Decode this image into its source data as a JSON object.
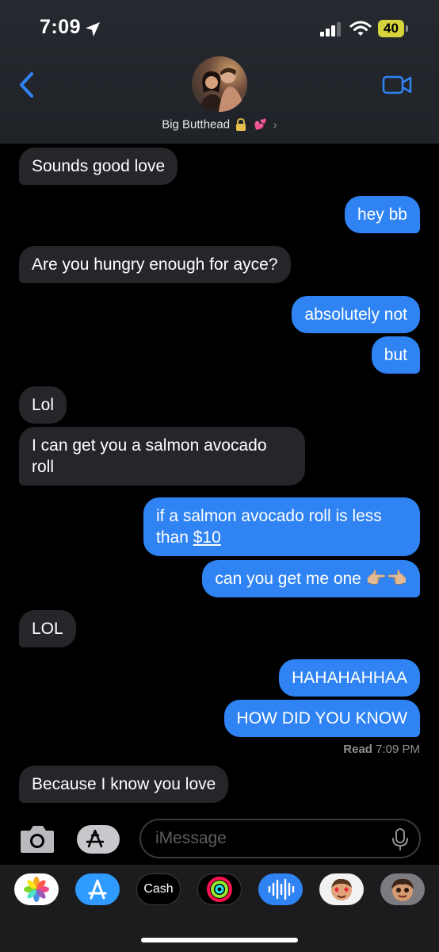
{
  "status_bar": {
    "time": "7:09",
    "battery": "40"
  },
  "contact": {
    "name": "Big Butthead",
    "heart_emoji": "💕"
  },
  "messages": [
    {
      "text": "Sounds good love"
    },
    {
      "text": "hey bb"
    },
    {
      "text": "Are you hungry enough for ayce?"
    },
    {
      "text": "absolutely not"
    },
    {
      "text": "but"
    },
    {
      "text": "Lol"
    },
    {
      "text": "I can get you a salmon avocado roll"
    },
    {
      "text_pre": "if a salmon avocado roll is less than",
      "link": "$10"
    },
    {
      "text": "can you get me one 👉🏼👈🏼"
    },
    {
      "text": "LOL"
    },
    {
      "text": "HAHAHAHHAA"
    },
    {
      "text": "HOW DID YOU KNOW"
    },
    {
      "text": "Because I know you love"
    }
  ],
  "read_receipt": {
    "label": "Read",
    "time": "7:09 PM"
  },
  "compose": {
    "placeholder": "iMessage"
  },
  "drawer": {
    "cash_label": "Cash"
  },
  "colors": {
    "outgoing": "#2f83f3",
    "incoming": "#26252a",
    "background": "#000000"
  },
  "icons": [
    "location-arrow-icon",
    "signal-icon",
    "wifi-icon",
    "battery-icon",
    "back-chevron-icon",
    "video-camera-icon",
    "lock-icon",
    "camera-icon",
    "app-store-icon",
    "microphone-icon"
  ]
}
